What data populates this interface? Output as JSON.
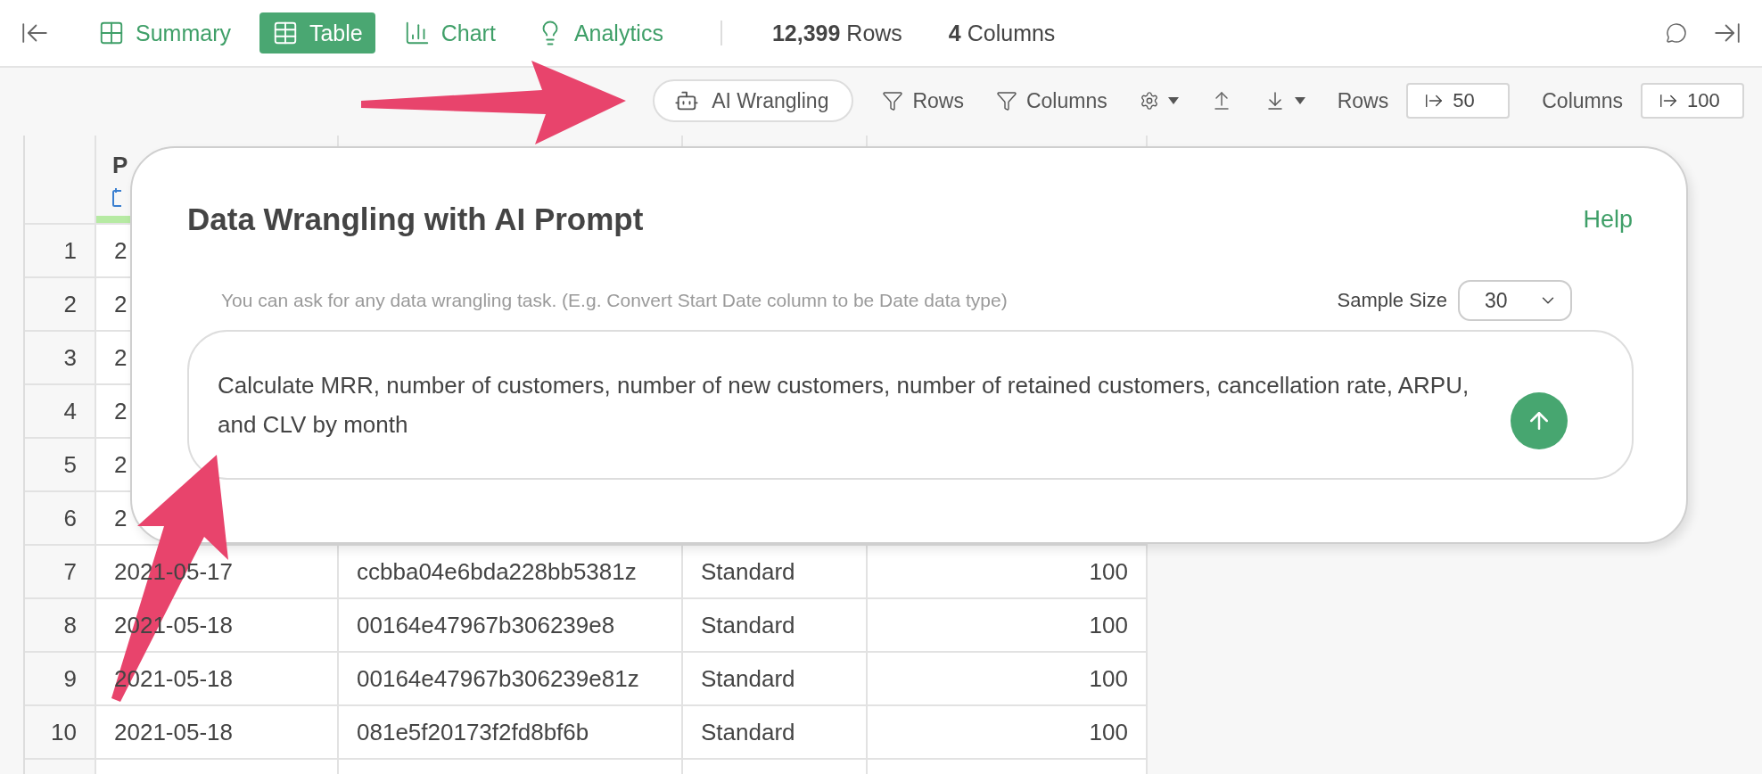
{
  "view_tabs": [
    {
      "kind": "summary",
      "label": "Summary",
      "selected": false
    },
    {
      "kind": "table",
      "label": "Table",
      "selected": true
    },
    {
      "kind": "chart",
      "label": "Chart",
      "selected": false
    },
    {
      "kind": "analytics",
      "label": "Analytics",
      "selected": false
    }
  ],
  "stats": [
    "**12,399** Rows",
    "**4** Columns"
  ],
  "toolbar": {
    "ai_button": "AI Wrangling",
    "filters": [
      "Rows",
      "Columns"
    ],
    "limits": [
      {
        "label": "Rows",
        "value": "50"
      },
      {
        "label": "Columns",
        "value": "100"
      }
    ]
  },
  "table": {
    "header": "P",
    "rows": [
      {
        "number": "1",
        "cells": [
          "2"
        ]
      },
      {
        "number": "2",
        "cells": [
          "2"
        ]
      },
      {
        "number": "3",
        "cells": [
          "2"
        ]
      },
      {
        "number": "4",
        "cells": [
          "2"
        ]
      },
      {
        "number": "5",
        "cells": [
          "2"
        ]
      },
      {
        "number": "6",
        "cells": [
          "2"
        ]
      },
      {
        "number": "7",
        "cells": [
          "2021-05-17",
          "ccbba04e6bda228bb5381z",
          "Standard",
          "100"
        ]
      },
      {
        "number": "8",
        "cells": [
          "2021-05-18",
          "00164e47967b306239e8",
          "Standard",
          "100"
        ]
      },
      {
        "number": "9",
        "cells": [
          "2021-05-18",
          "00164e47967b306239e81z",
          "Standard",
          "100"
        ]
      },
      {
        "number": "10",
        "cells": [
          "2021-05-18",
          "081e5f20173f2fd8bf6b",
          "Standard",
          "100"
        ]
      }
    ]
  },
  "dialog": {
    "title": "Data Wrangling with AI Prompt",
    "help": "Help",
    "hint": "You can ask for any data wrangling task. (E.g. Convert Start Date column to be Date data type)",
    "sample_size": {
      "label": "Sample Size",
      "value": "30"
    },
    "prompt": "Calculate MRR, number of customers, number of new customers, number of retained customers, cancellation rate, ARPU, and CLV by month"
  }
}
